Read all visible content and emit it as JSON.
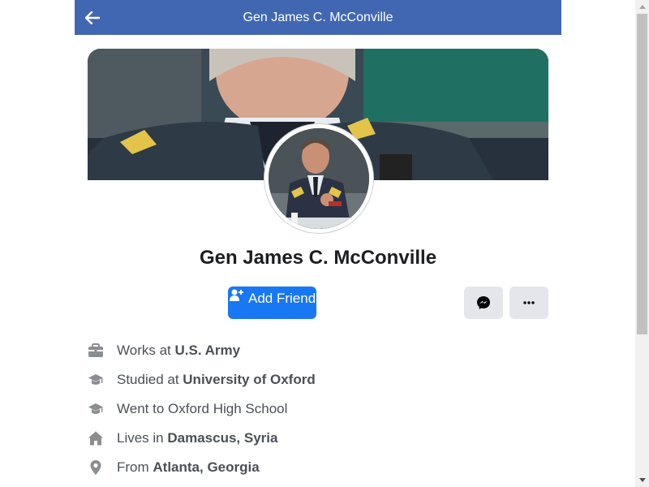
{
  "header": {
    "title": "Gen James C. McConville"
  },
  "profile": {
    "name": "Gen James C. McConville"
  },
  "actions": {
    "add_friend_label": "Add Friend"
  },
  "info": {
    "work_prefix": "Works at ",
    "work_value": "U.S. Army",
    "study_prefix": "Studied at ",
    "study_value": "University of Oxford",
    "school_text": "Went to Oxford High School",
    "lives_prefix": "Lives in ",
    "lives_value": "Damascus, Syria",
    "from_prefix": "From ",
    "from_value": "Atlanta, Georgia"
  },
  "colors": {
    "header_bg": "#4267b2",
    "primary_button": "#1877f2",
    "secondary_button": "#e4e6eb",
    "info_text": "#4b4f56"
  },
  "icons": {
    "back": "arrow-left-icon",
    "add_friend": "person-add-icon",
    "messenger": "messenger-icon",
    "more": "more-dots-icon",
    "work": "briefcase-icon",
    "study": "graduation-cap-icon",
    "school": "graduation-cap-icon",
    "lives": "home-icon",
    "from": "location-pin-icon"
  }
}
